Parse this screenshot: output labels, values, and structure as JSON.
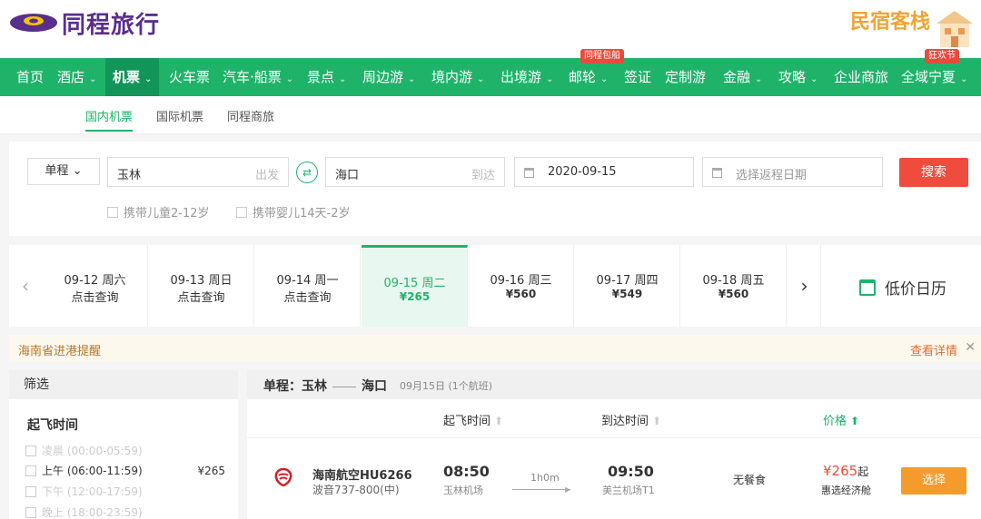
{
  "brand": {
    "logo_text": "同程旅行",
    "bnb_text": "民宿客栈",
    "accent": "#1fb36a",
    "logo_color": "#5a2f8c"
  },
  "nav": {
    "items": [
      {
        "label": "首页",
        "caret": false
      },
      {
        "label": "酒店",
        "caret": true
      },
      {
        "label": "机票",
        "caret": true,
        "active": true
      },
      {
        "label": "火车票",
        "caret": false
      },
      {
        "label": "汽车·船票",
        "caret": true
      },
      {
        "label": "景点",
        "caret": true
      },
      {
        "label": "周边游",
        "caret": true
      },
      {
        "label": "境内游",
        "caret": true
      },
      {
        "label": "出境游",
        "caret": true
      },
      {
        "label": "邮轮",
        "caret": true
      },
      {
        "label": "签证",
        "caret": false
      },
      {
        "label": "定制游",
        "caret": false
      },
      {
        "label": "金融",
        "caret": true
      },
      {
        "label": "攻略",
        "caret": true
      },
      {
        "label": "企业商旅",
        "caret": false
      },
      {
        "label": "全域宁夏",
        "caret": true
      }
    ],
    "caret_glyph": "⌄",
    "tag_cruise": "同程包船",
    "tag_festival": "狂欢节"
  },
  "subtabs": [
    "国内机票",
    "国际机票",
    "同程商旅"
  ],
  "search": {
    "trip_type": "单程",
    "from_value": "玉林",
    "from_hint": "出发",
    "to_value": "海口",
    "to_hint": "到达",
    "depart_date": "2020-09-15",
    "return_placeholder": "选择返程日期",
    "search_label": "搜索",
    "child_label": "携带儿童2-12岁",
    "infant_label": "携带婴儿14天-2岁"
  },
  "dates": [
    {
      "date": "09-12 周六",
      "price": "点击查询",
      "has_price": false
    },
    {
      "date": "09-13 周日",
      "price": "点击查询",
      "has_price": false
    },
    {
      "date": "09-14 周一",
      "price": "点击查询",
      "has_price": false
    },
    {
      "date": "09-15 周二",
      "price": "¥265",
      "has_price": true,
      "active": true
    },
    {
      "date": "09-16 周三",
      "price": "¥560",
      "has_price": true
    },
    {
      "date": "09-17 周四",
      "price": "¥549",
      "has_price": true
    },
    {
      "date": "09-18 周五",
      "price": "¥560",
      "has_price": true
    }
  ],
  "low_price_calendar": "低价日历",
  "notice": {
    "text": "海南省进港提醒",
    "more": "查看详情"
  },
  "filter": {
    "header": "筛选",
    "title": "起飞时间",
    "rows": [
      {
        "label": "凌晨 (00:00-05:59)",
        "price": "",
        "enabled": false
      },
      {
        "label": "上午 (06:00-11:59)",
        "price": "¥265",
        "enabled": true
      },
      {
        "label": "下午 (12:00-17:59)",
        "price": "",
        "enabled": false
      },
      {
        "label": "晚上 (18:00-23:59)",
        "price": "",
        "enabled": false
      }
    ]
  },
  "results": {
    "route_prefix": "单程：",
    "from": "玉林",
    "to": "海口",
    "date": "09月15日",
    "count": "(1个航班)",
    "col_depart": "起飞时间",
    "col_arrive": "到达时间",
    "col_price": "价格",
    "flight": {
      "airline": "海南航空HU6266",
      "plane": "波音737-800(中)",
      "dep_time": "08:50",
      "dep_airport": "玉林机场",
      "duration": "1h0m",
      "arr_time": "09:50",
      "arr_airport": "美兰机场T1",
      "meal": "无餐食",
      "price": "¥265",
      "price_suffix": "起",
      "cabin": "惠选经济舱",
      "select_label": "选择"
    }
  }
}
